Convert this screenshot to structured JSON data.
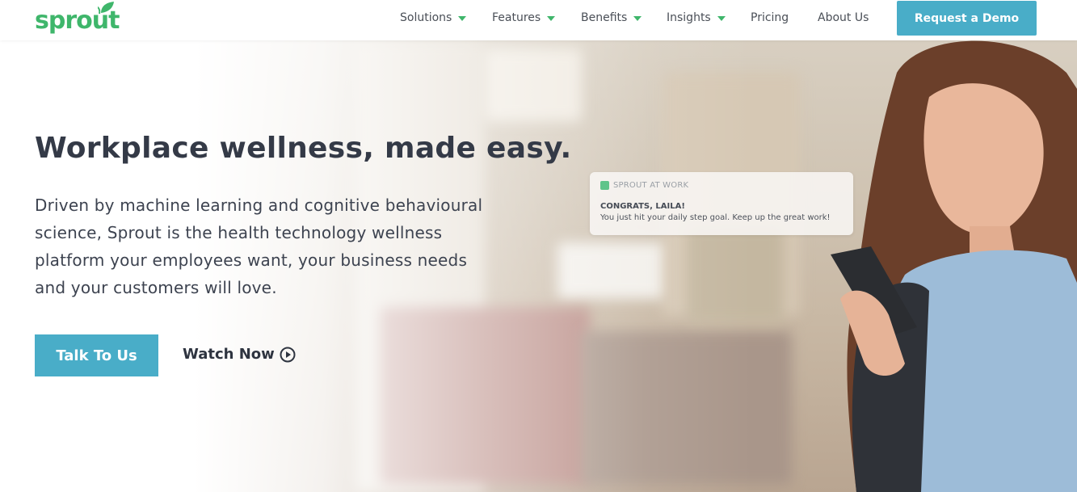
{
  "header": {
    "logo_text": "sprout",
    "nav": [
      {
        "label": "Solutions",
        "dropdown": true
      },
      {
        "label": "Features",
        "dropdown": true
      },
      {
        "label": "Benefits",
        "dropdown": true
      },
      {
        "label": "Insights",
        "dropdown": true
      },
      {
        "label": "Pricing",
        "dropdown": false
      },
      {
        "label": "About Us",
        "dropdown": false
      }
    ],
    "cta_label": "Request a Demo"
  },
  "hero": {
    "headline": "Workplace wellness, made easy.",
    "subtext": "Driven by machine learning and cognitive behavioural science, Sprout is the health technology wellness platform your employees want, your business needs and your customers will love.",
    "primary_button": "Talk To Us",
    "secondary_button": "Watch Now",
    "notification": {
      "app": "SPROUT AT WORK",
      "title": "CONGRATS, LAILA!",
      "body": "You just hit your daily step goal. Keep up the great work!"
    }
  },
  "colors": {
    "brand_green": "#3fb66b",
    "accent_blue": "#49adc8",
    "text_dark": "#343a47"
  }
}
